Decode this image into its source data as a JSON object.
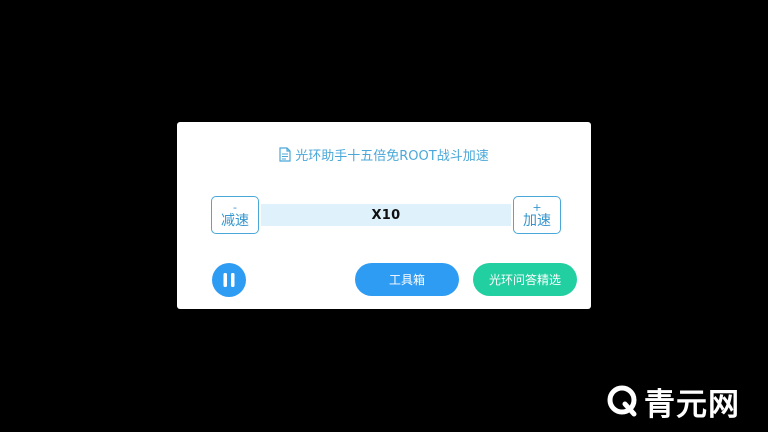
{
  "dialog": {
    "title": "光环助手十五倍免ROOT战斗加速",
    "title_icon": "document-icon",
    "speed": {
      "decrease_symbol": "-",
      "decrease_label": "减速",
      "value": "X10",
      "increase_symbol": "+",
      "increase_label": "加速"
    },
    "pause_icon": "pause-icon",
    "toolbox_label": "工具箱",
    "qa_label": "光环问答精选"
  },
  "watermark": {
    "text": "青元网",
    "icon": "q-logo-icon"
  },
  "colors": {
    "background": "#000000",
    "dialog": "#ffffff",
    "accent_text": "#4aa8d8",
    "blue_button": "#2f9cf4",
    "green_button": "#22cfa0",
    "speed_bar": "#dff2fb"
  }
}
